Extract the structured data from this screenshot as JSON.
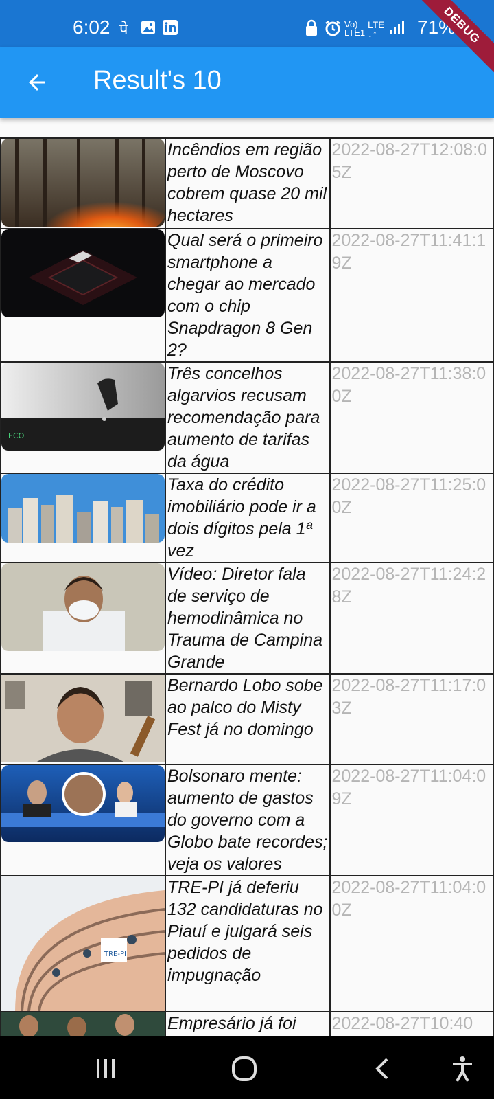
{
  "status_bar": {
    "time": "6:02",
    "battery": "71%",
    "network": "LTE1",
    "network_type": "LTE"
  },
  "debug_banner": "DEBUG",
  "app_bar": {
    "title": "Result's 10",
    "back_icon": "arrow-back-icon"
  },
  "articles": [
    {
      "title": "Incêndios em região perto de Moscovo cobrem quase 20 mil hectares",
      "published_at": "2022-08-27T12:08:05Z",
      "image": "forest-fire"
    },
    {
      "title": "Qual será o primeiro smartphone a chegar ao mercado com o chip Snapdragon 8 Gen 2?",
      "published_at": "2022-08-27T11:41:19Z",
      "image": "processor-chip"
    },
    {
      "title": "Três concelhos algarvios recusam recomendação para aumento de tarifas da água",
      "published_at": "2022-08-27T11:38:00Z",
      "image": "water-tap"
    },
    {
      "title": "Taxa do crédito imobiliário pode ir a dois dígitos pela 1ª vez",
      "published_at": "2022-08-27T11:25:00Z",
      "image": "city-skyline"
    },
    {
      "title": "Vídeo: Diretor fala de serviço de hemodinâmica no Trauma de Campina Grande",
      "published_at": "2022-08-27T11:24:28Z",
      "image": "man-with-mask"
    },
    {
      "title": "Bernardo Lobo sobe ao palco do Misty Fest já no domingo",
      "published_at": "2022-08-27T11:17:03Z",
      "image": "man-with-guitar"
    },
    {
      "title": "Bolsonaro mente: aumento de gastos do governo com a Globo bate recordes; veja os valores",
      "published_at": "2022-08-27T11:04:09Z",
      "image": "tv-news-studio"
    },
    {
      "title": "TRE-PI já deferiu 132 candidaturas no Piauí e julgará seis pedidos de impugnação",
      "published_at": "2022-08-27T11:04:00Z",
      "image": "tre-pi-building",
      "logo_text": "TRE-PI"
    },
    {
      "title": "Empresário já foi",
      "published_at": "2022-08-27T10:40",
      "image": "football-players"
    }
  ],
  "nav_bar": {
    "recents_icon": "recents-icon",
    "home_icon": "home-icon",
    "back_icon": "back-icon",
    "accessibility_icon": "accessibility-icon"
  }
}
